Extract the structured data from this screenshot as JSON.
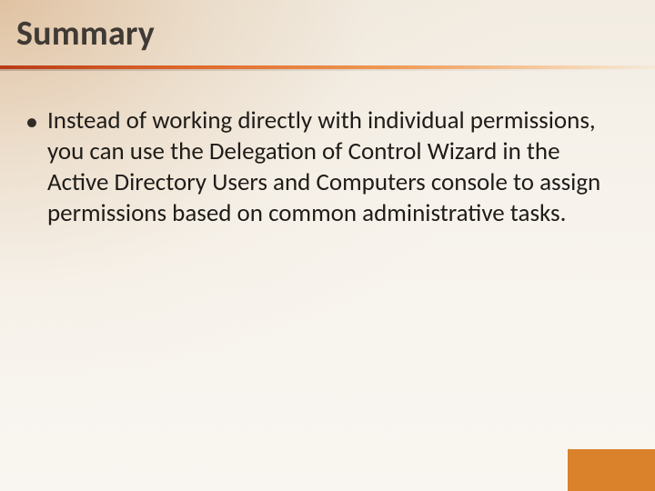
{
  "title": "Summary",
  "bullets": [
    "Instead of working directly with individual permissions, you can use the Delegation of Control Wizard in the Active Directory Users and Computers console to assign permissions based on common administrative tasks."
  ],
  "bullet_glyph": "•"
}
